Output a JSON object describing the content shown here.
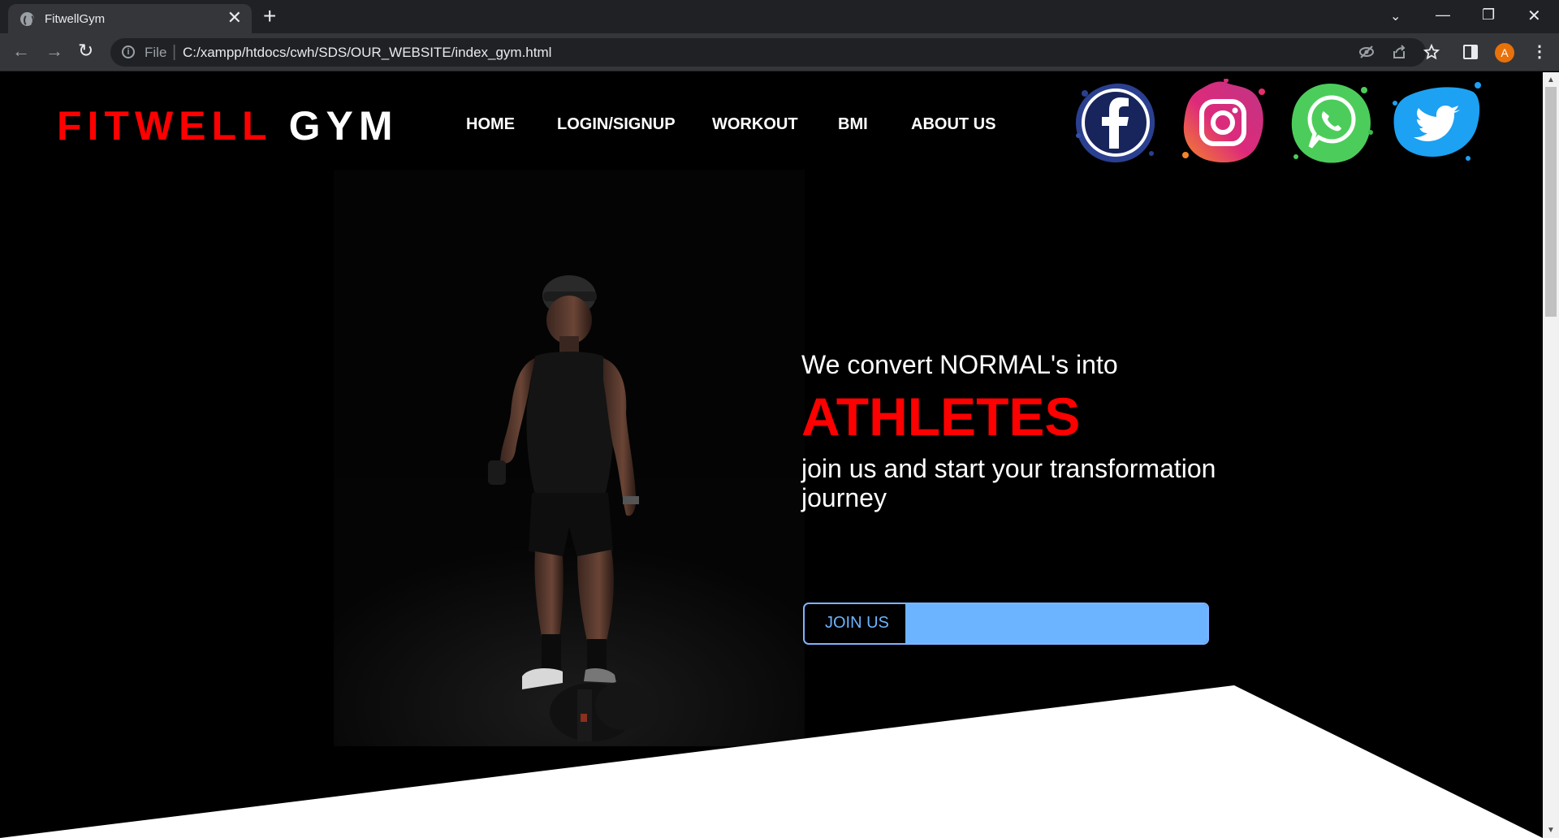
{
  "browser": {
    "tab_title": "FitwellGym",
    "tab_close": "✕",
    "new_tab": "+",
    "address_prefix": "File",
    "address_url": "C:/xampp/htdocs/cwh/SDS/OUR_WEBSITE/index_gym.html",
    "avatar_letter": "A",
    "window_controls": {
      "list": "⌄",
      "minimize": "—",
      "maximize": "❐",
      "close": "✕"
    }
  },
  "site": {
    "logo_red": "FITWELL",
    "logo_white": "GYM",
    "nav": {
      "home": "HOME",
      "login": "LOGIN/SIGNUP",
      "workout": "WORKOUT",
      "bmi": "BMI",
      "about": "ABOUT US"
    },
    "social_icons": [
      "facebook-icon",
      "instagram-icon",
      "whatsapp-icon",
      "twitter-icon"
    ],
    "hero": {
      "line1": "We convert NORMAL's into",
      "headline": "ATHLETES",
      "line3": "join us and start your transformation journey",
      "join_button": "JOIN US"
    }
  },
  "colors": {
    "accent_red": "#ff0000",
    "button_blue": "#6cb4ff",
    "background": "#000000",
    "facebook": "#1e2d6e",
    "instagram": "#e1306c",
    "whatsapp": "#4ccd5b",
    "twitter": "#1da1f2"
  }
}
